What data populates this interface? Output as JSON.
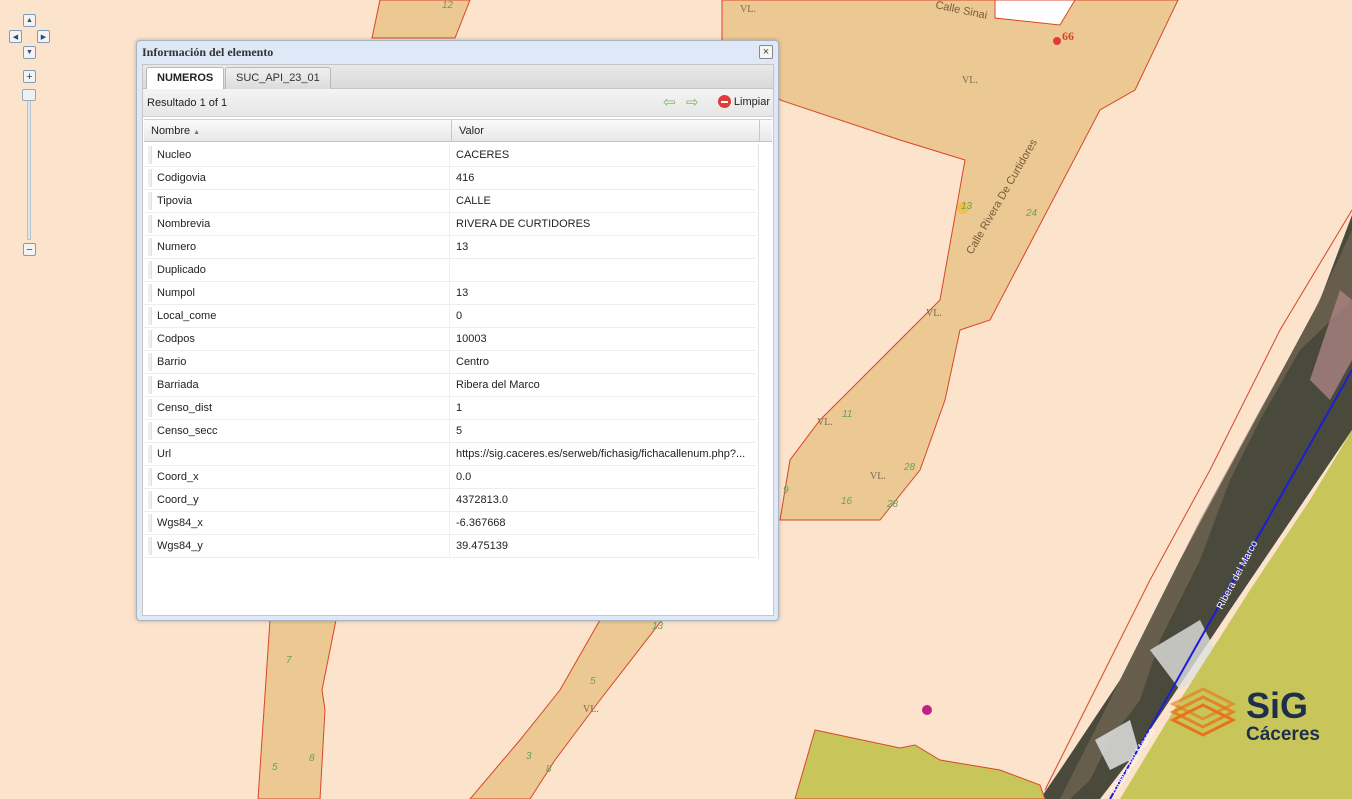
{
  "map": {
    "labels": {
      "vl": "VL.",
      "street_sinai": "Calle   Sinai",
      "street_curtidores": "Calle   Rivera De Curtidores",
      "street_ribera": "Ribera   del Marco",
      "street_ribera2": "Ribera del Marco",
      "parcel_numbers": [
        "12",
        "66",
        "13",
        "24",
        "11",
        "28",
        "9",
        "16",
        "28",
        "7",
        "5",
        "8",
        "13",
        "5",
        "3",
        "8"
      ]
    },
    "colors": {
      "background": "#fbe3cc",
      "block": "#ecc892",
      "block_border": "#d8462a",
      "green": "#c8c65a",
      "road_line": "#1d1dd6"
    }
  },
  "navigation": {
    "pan_up": "▲",
    "pan_left": "◀",
    "pan_right": "▶",
    "pan_down": "▼",
    "zoom_in": "+",
    "zoom_out": "−"
  },
  "dialog": {
    "title": "Información del elemento",
    "close_icon": "×",
    "tabs": [
      {
        "label": "NUMEROS"
      },
      {
        "label": "SUC_API_23_01"
      }
    ],
    "toolbar": {
      "result": "Resultado 1 of 1",
      "prev_icon": "⇦",
      "next_icon": "⇨",
      "clear_label": "Limpiar"
    },
    "grid": {
      "columns": [
        {
          "label": "Nombre"
        },
        {
          "label": "Valor"
        }
      ],
      "sort_icon": "▲",
      "rows": [
        {
          "name": "Nucleo",
          "value": "CACERES"
        },
        {
          "name": "Codigovia",
          "value": "416"
        },
        {
          "name": "Tipovia",
          "value": "CALLE"
        },
        {
          "name": "Nombrevia",
          "value": "RIVERA DE CURTIDORES"
        },
        {
          "name": "Numero",
          "value": "13"
        },
        {
          "name": "Duplicado",
          "value": ""
        },
        {
          "name": "Numpol",
          "value": "13"
        },
        {
          "name": "Local_come",
          "value": "0"
        },
        {
          "name": "Codpos",
          "value": "10003"
        },
        {
          "name": "Barrio",
          "value": "Centro"
        },
        {
          "name": "Barriada",
          "value": "Ribera del Marco"
        },
        {
          "name": "Censo_dist",
          "value": "1"
        },
        {
          "name": "Censo_secc",
          "value": "5"
        },
        {
          "name": "Url",
          "value": "https://sig.caceres.es/serweb/fichasig/fichacallenum.php?..."
        },
        {
          "name": "Coord_x",
          "value": "0.0"
        },
        {
          "name": "Coord_y",
          "value": "4372813.0"
        },
        {
          "name": "Wgs84_x",
          "value": "-6.367668"
        },
        {
          "name": "Wgs84_y",
          "value": "39.475139"
        }
      ]
    }
  },
  "logo": {
    "line1": "SiG",
    "line2": "Cáceres"
  }
}
